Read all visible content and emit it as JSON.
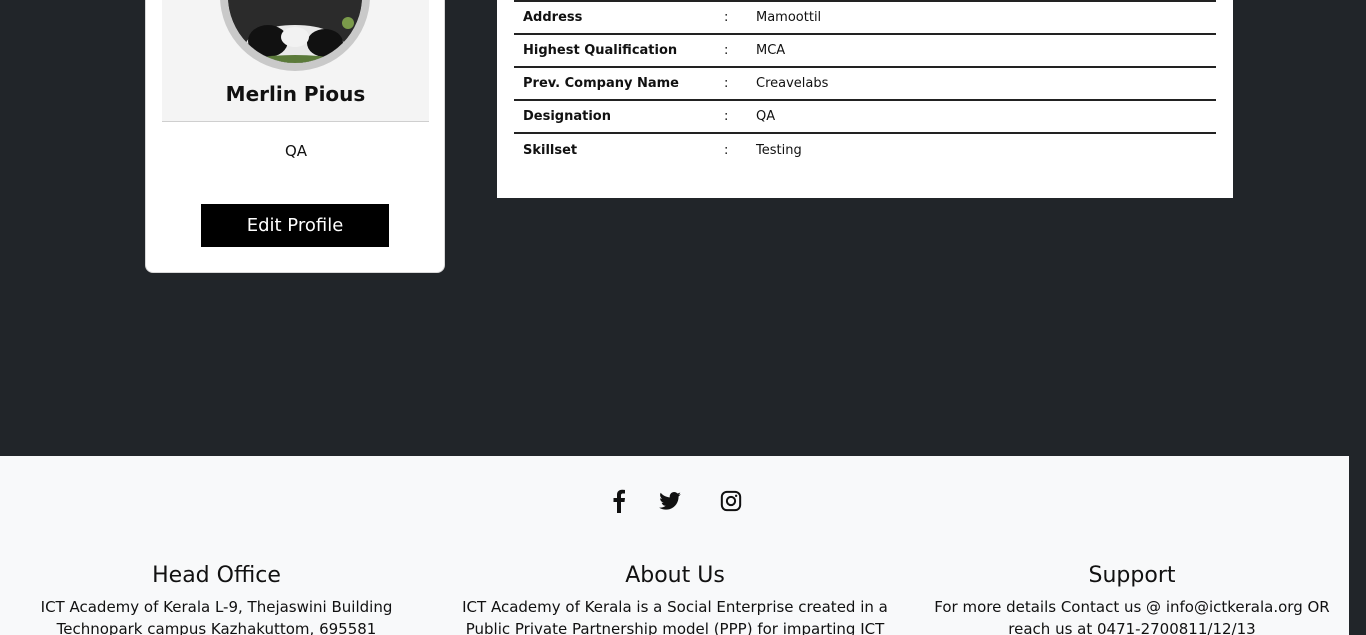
{
  "profile": {
    "name": "Merlin Pious",
    "role": "QA",
    "edit_label": "Edit Profile"
  },
  "details": {
    "rows": [
      {
        "label": "Address",
        "sep": ":",
        "value": "Mamoottil"
      },
      {
        "label": "Highest Qualification",
        "sep": ":",
        "value": "MCA"
      },
      {
        "label": "Prev. Company Name",
        "sep": ":",
        "value": "Creavelabs"
      },
      {
        "label": "Designation",
        "sep": ":",
        "value": "QA"
      },
      {
        "label": "Skillset",
        "sep": ":",
        "value": "Testing"
      }
    ]
  },
  "footer": {
    "social": [
      "facebook-icon",
      "twitter-icon",
      "instagram-icon"
    ],
    "head_office": {
      "title": "Head Office",
      "text": "ICT Academy of Kerala L-9, Thejaswini Building Technopark campus Kazhakuttom, 695581"
    },
    "about": {
      "title": "About Us",
      "text": "ICT Academy of Kerala is a Social Enterprise created in a Public Private Partnership model (PPP) for imparting ICT skills"
    },
    "support": {
      "title": "Support",
      "text": "For more details Contact us @ info@ictkerala.org OR reach us at 0471-2700811/12/13"
    }
  },
  "colors": {
    "page_bg": "#212529",
    "footer_bg": "#f8f9fa",
    "button_bg": "#000000"
  }
}
